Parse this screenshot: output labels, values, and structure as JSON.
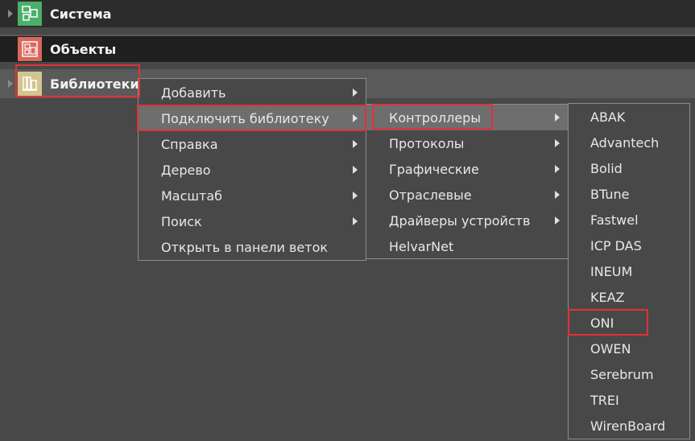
{
  "tree": {
    "rows": [
      {
        "label": "Система"
      },
      {
        "label": "Объекты"
      },
      {
        "label": "Библиотеки"
      }
    ]
  },
  "menu1": {
    "items": [
      "Добавить",
      "Подключить библиотеку",
      "Справка",
      "Дерево",
      "Масштаб",
      "Поиск",
      "Открыть в панели веток"
    ]
  },
  "menu2": {
    "items": [
      "Контроллеры",
      "Протоколы",
      "Графические",
      "Отраслевые",
      "Драйверы устройств",
      "HelvarNet"
    ]
  },
  "menu3": {
    "items": [
      "ABAK",
      "Advantech",
      "Bolid",
      "BTune",
      "Fastwel",
      "ICP DAS",
      "INEUM",
      "KEAZ",
      "ONI",
      "OWEN",
      "Serebrum",
      "TREI",
      "WirenBoard"
    ]
  },
  "colors": {
    "highlight": "#e0323a",
    "background": "#484848",
    "menu_active": "#6e6e6e"
  }
}
